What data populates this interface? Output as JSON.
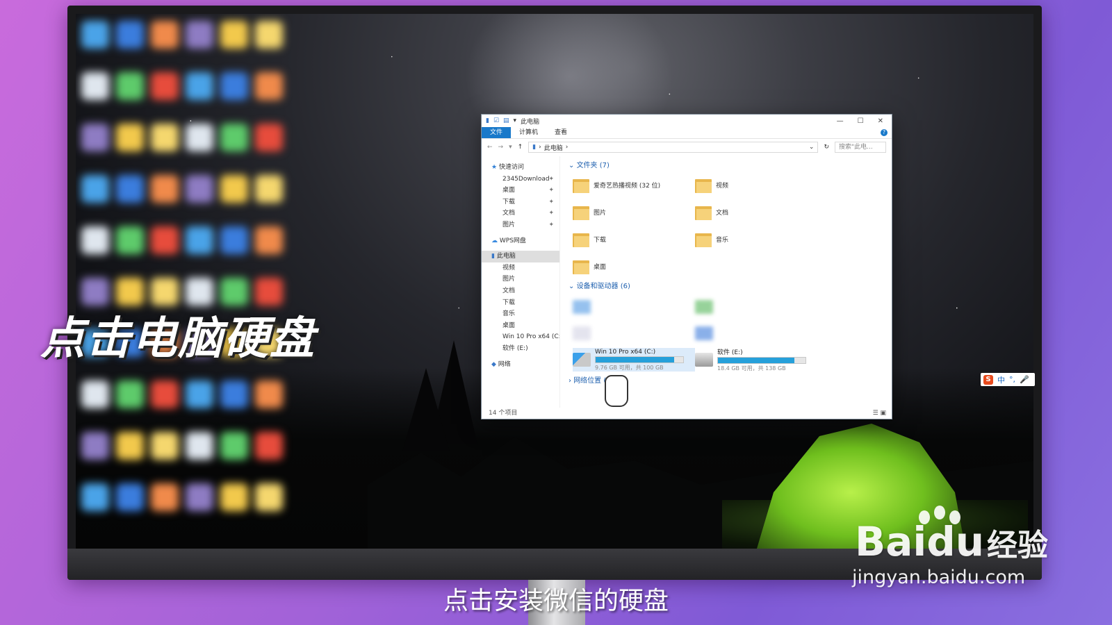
{
  "overlay": {
    "title": "点击电脑硬盘",
    "subtitle": "点击安装微信的硬盘",
    "watermark_brand": "Bai",
    "watermark_brand_du": "du",
    "watermark_cn": "经验",
    "watermark_url": "jingyan.baidu.com"
  },
  "ime": {
    "logo": "S",
    "mode": "中",
    "punct": "°,",
    "mic": "🎤"
  },
  "explorer": {
    "title": "此电脑",
    "ribbon_tabs": [
      "文件",
      "计算机",
      "查看"
    ],
    "address": "此电脑",
    "search_placeholder": "搜索\"此电...",
    "nav": {
      "quick_access": "快速访问",
      "quick_items": [
        "2345Download",
        "桌面",
        "下载",
        "文档",
        "图片"
      ],
      "wps": "WPS网盘",
      "this_pc": "此电脑",
      "pc_items": [
        "视频",
        "图片",
        "文档",
        "下载",
        "音乐",
        "桌面",
        "Win 10 Pro x64 (C:",
        "软件 (E:)"
      ],
      "network": "网络"
    },
    "folders_header": "文件夹 (7)",
    "folders": [
      "爱奇艺热播视频 (32 位)",
      "视频",
      "图片",
      "文档",
      "下载",
      "音乐",
      "桌面"
    ],
    "devices_header": "设备和驱动器 (6)",
    "drives": [
      {
        "name": "Win 10 Pro x64 (C:)",
        "detail": "9.76 GB 可用，共 100 GB",
        "used_fraction": 0.9
      },
      {
        "name": "软件 (E:)",
        "detail": "18.4 GB 可用，共 138 GB",
        "used_fraction": 0.87
      }
    ],
    "network_header": "网络位置 (",
    "status": "14 个项目"
  },
  "colors": {
    "accent": "#1979ca",
    "bar_fill": "#26a0da",
    "group_header": "#1d5fae",
    "tent": "#8fd82c"
  }
}
